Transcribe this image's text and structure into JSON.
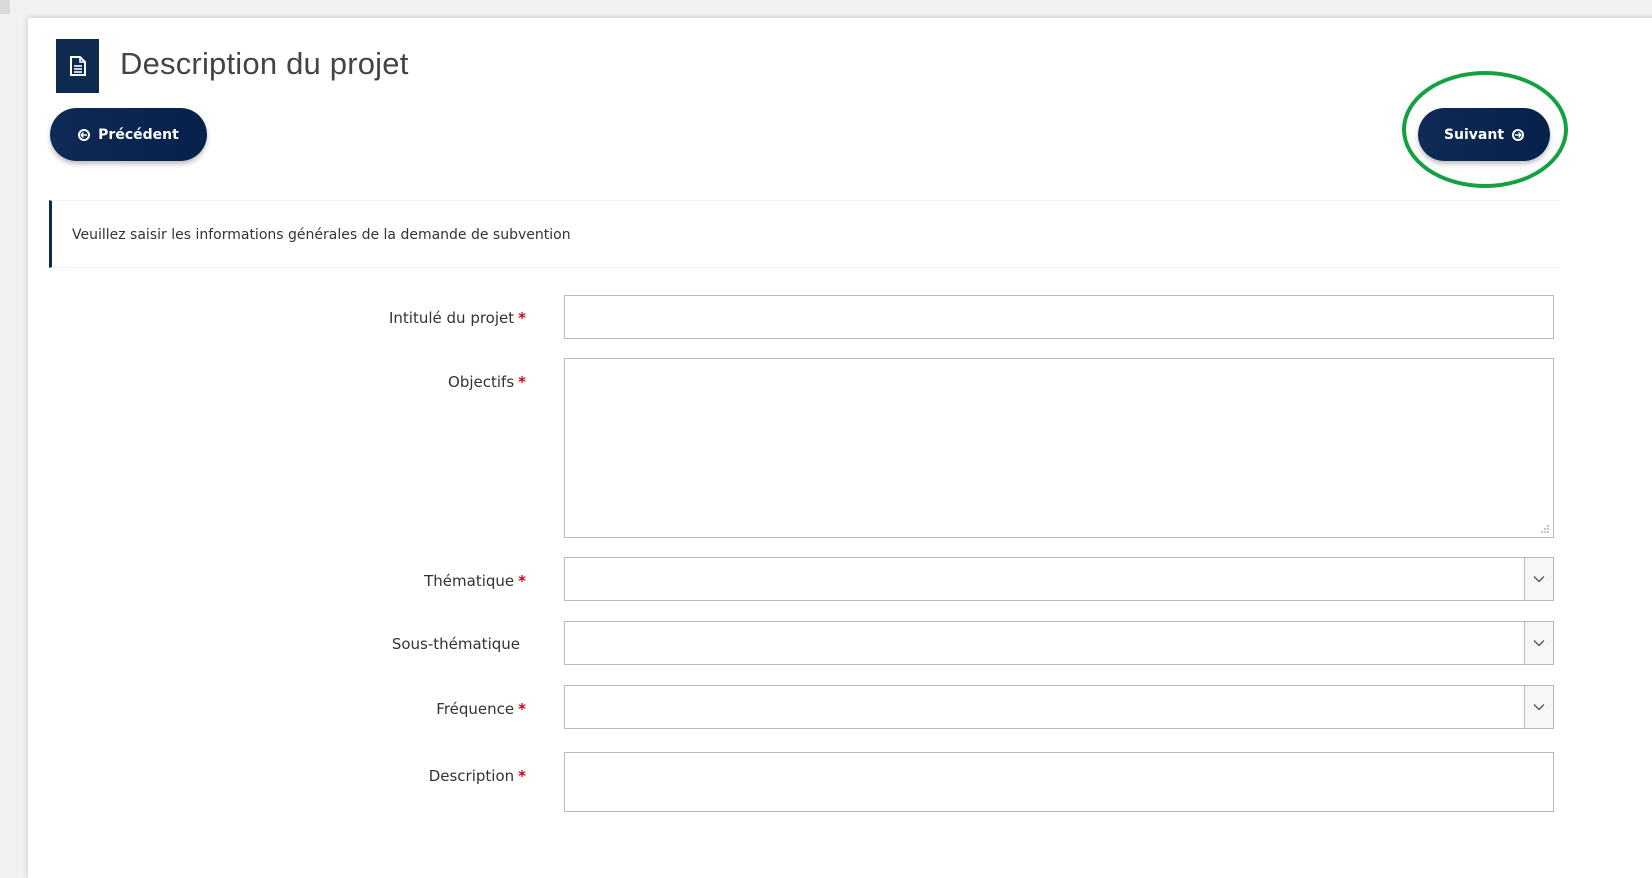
{
  "header": {
    "title": "Description du projet",
    "icon": "document-icon"
  },
  "nav": {
    "prev_label": "Précédent",
    "next_label": "Suivant",
    "prev_icon": "circle-arrow-left-icon",
    "next_icon": "circle-arrow-right-icon",
    "highlight_color": "#13a142"
  },
  "info": {
    "text": "Veuillez saisir les informations générales de la demande de subvention"
  },
  "form": {
    "required_mark": "*",
    "fields": [
      {
        "label": "Intitulé du projet",
        "required": true,
        "type": "text",
        "value": ""
      },
      {
        "label": "Objectifs",
        "required": true,
        "type": "textarea",
        "value": ""
      },
      {
        "label": "Thématique",
        "required": true,
        "type": "select",
        "value": ""
      },
      {
        "label": "Sous-thématique",
        "required": false,
        "type": "select",
        "value": ""
      },
      {
        "label": "Fréquence",
        "required": true,
        "type": "select",
        "value": ""
      },
      {
        "label": "Description",
        "required": true,
        "type": "textarea",
        "value": ""
      }
    ]
  },
  "colors": {
    "primary": "#0f2a4f",
    "required": "#d0021b",
    "background": "#f1f1f1"
  }
}
